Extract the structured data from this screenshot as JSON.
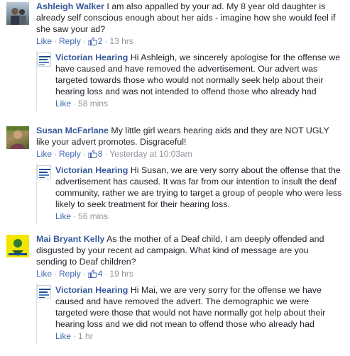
{
  "comments": [
    {
      "author": "Ashleigh Walker",
      "text": "I am also appalled by your ad. My 8 year old daughter is already self conscious enough about her aids - imagine how she would feel if she saw your ad?",
      "like_label": "Like",
      "reply_label": "Reply",
      "likes": "2",
      "time": "13 hrs",
      "reply": {
        "author": "Victorian Hearing",
        "text": "Hi Ashleigh, we sincerely apologise for the offense we have caused and have removed the advertisement. Our advert was targeted towards those who would not normally seek help about their hearing loss and was not intended to offend those who already had",
        "like_label": "Like",
        "time": "58 mins"
      }
    },
    {
      "author": "Susan McFarlane",
      "text": "My little girl wears hearing aids and they are NOT UGLY like your advert promotes. Disgraceful!",
      "like_label": "Like",
      "reply_label": "Reply",
      "likes": "8",
      "time": "Yesterday at 10:03am",
      "reply": {
        "author": "Victorian Hearing",
        "text": "Hi Susan, we are very sorry about the offense that the advertisement has caused. It was far from our intention to insult the deaf community, rather we are trying to target a group of people who were less likely to seek treatment for their hearing loss.",
        "like_label": "Like",
        "time": "56 mins"
      }
    },
    {
      "author": "Mai Bryant Kelly",
      "text": "As the mother of a Deaf child, I am deeply offended and disgusted by your recent ad campaign. What kind of message are you sending to Deaf children?",
      "like_label": "Like",
      "reply_label": "Reply",
      "likes": "4",
      "time": "19 hrs",
      "reply": {
        "author": "Victorian Hearing",
        "text": "Hi Mai, we are very sorry for the offense we have caused and have removed the advert. The demographic we were targeted were those that would not have normally got help about their hearing loss and we did not mean to offend those who already had",
        "like_label": "Like",
        "time": "1 hr"
      }
    }
  ],
  "colors": {
    "link": "#365899",
    "action": "#4267b2",
    "meta": "#90949c",
    "text": "#1d2129"
  },
  "icons": {
    "thumbs_up": "thumbs-up-icon"
  }
}
